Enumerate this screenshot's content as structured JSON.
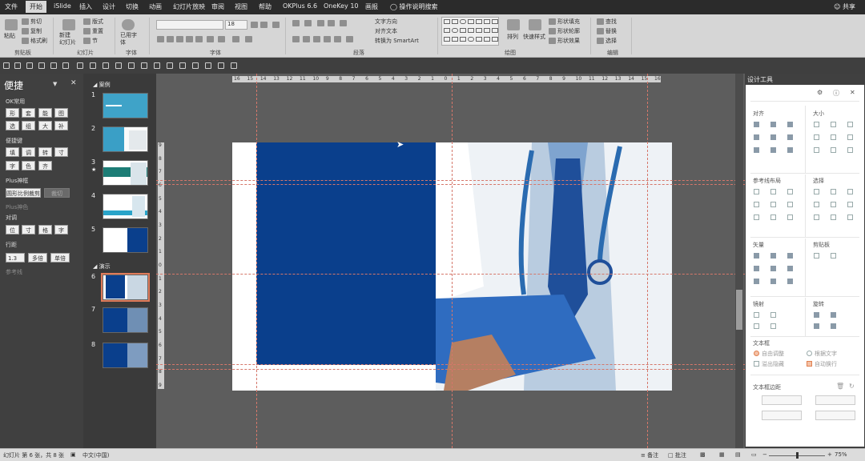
{
  "tabs": [
    {
      "label": "文件",
      "active": false
    },
    {
      "label": "开始",
      "active": true
    },
    {
      "label": "iSlide",
      "active": false
    },
    {
      "label": "插入",
      "active": false
    },
    {
      "label": "设计",
      "active": false
    },
    {
      "label": "切换",
      "active": false
    },
    {
      "label": "动画",
      "active": false
    },
    {
      "label": "幻灯片放映",
      "active": false
    },
    {
      "label": "审阅",
      "active": false
    },
    {
      "label": "视图",
      "active": false
    },
    {
      "label": "帮助",
      "active": false
    },
    {
      "label": "OKPlus 6.6",
      "active": false
    },
    {
      "label": "OneKey 10",
      "active": false
    },
    {
      "label": "画报",
      "active": false
    }
  ],
  "search_label": "操作说明搜索",
  "share_label": "共享",
  "ribbon": {
    "paste": "粘贴",
    "cut": "剪切",
    "copy": "复制",
    "format_painter": "格式刷",
    "new_slide": "新建\n幻灯片",
    "layout": "版式",
    "reset": "重置",
    "section": "节",
    "used_font": "已用字\n体",
    "font_size": "18",
    "text_direction": "文字方向",
    "align_text": "对齐文本",
    "smartart": "转换为 SmartArt",
    "arrange": "排列",
    "quick_styles": "快速样式",
    "shape_fill": "形状填充",
    "shape_outline": "形状轮廓",
    "shape_effects": "形状效果",
    "find": "查找",
    "replace": "替换",
    "select": "选择",
    "groups": [
      "剪贴板",
      "幻灯片",
      "字体",
      "字体",
      "段落",
      "绘图",
      "编辑"
    ]
  },
  "left_panel": {
    "title": "便捷",
    "ok_common": "OK常用",
    "ok_buttons": [
      "形",
      "套",
      "能",
      "图",
      "选",
      "组",
      "大",
      "补"
    ],
    "shortcut": "便捷键",
    "shortcut_buttons": [
      "填",
      "调",
      "转",
      "寸",
      "字",
      "色",
      "齐"
    ],
    "plus_magic": "Plus神框",
    "rounded_ratio": "圆形比例裁剪",
    "disabled_btn": "裁切",
    "plus_color": "Plus神色",
    "align_label": "对调",
    "align_buttons": [
      "位",
      "寸",
      "格",
      "字"
    ],
    "line_spacing": "行距",
    "line_value": "1.3",
    "multi_line": "多倍",
    "single_line": "单倍",
    "ref_line": "参考线"
  },
  "thumbs": {
    "section1": "案例",
    "section2": "演示",
    "numbers": [
      "1",
      "2",
      "3",
      "4",
      "5",
      "6",
      "7",
      "8"
    ]
  },
  "ruler": {
    "h_ticks": [
      "16",
      "15",
      "14",
      "13",
      "12",
      "11",
      "10",
      "9",
      "8",
      "7",
      "6",
      "5",
      "4",
      "3",
      "2",
      "1",
      "0",
      "1",
      "2",
      "3",
      "4",
      "5",
      "6",
      "7",
      "8",
      "9",
      "10",
      "11",
      "12",
      "13",
      "14",
      "15",
      "16"
    ],
    "v_ticks": [
      "9",
      "8",
      "7",
      "6",
      "5",
      "4",
      "3",
      "2",
      "1",
      "0",
      "1",
      "2",
      "3",
      "4",
      "5",
      "6",
      "7",
      "8",
      "9"
    ]
  },
  "right_panel": {
    "title": "设计工具",
    "align": "对齐",
    "size": "大小",
    "guides": "参考线布局",
    "select": "选择",
    "vector": "矢量",
    "clipboard": "剪贴板",
    "mirror": "镜射",
    "rotate": "旋转",
    "textbox": "文本框",
    "auto_adjust": "自由调整",
    "shape_text": "根据文字",
    "overflow": "溢出隐藏",
    "autowrap": "自动换行",
    "margins": "文本框边距"
  },
  "status": {
    "slide_info": "幻灯片 第 6 张，共 8 张",
    "language": "中文(中国)",
    "notes": "备注",
    "comments": "批注",
    "zoom": "75%",
    "zoom_fraction": 0.5
  },
  "colors": {
    "slide_block": "#0a3f8c",
    "accent": "#e07b5a"
  }
}
